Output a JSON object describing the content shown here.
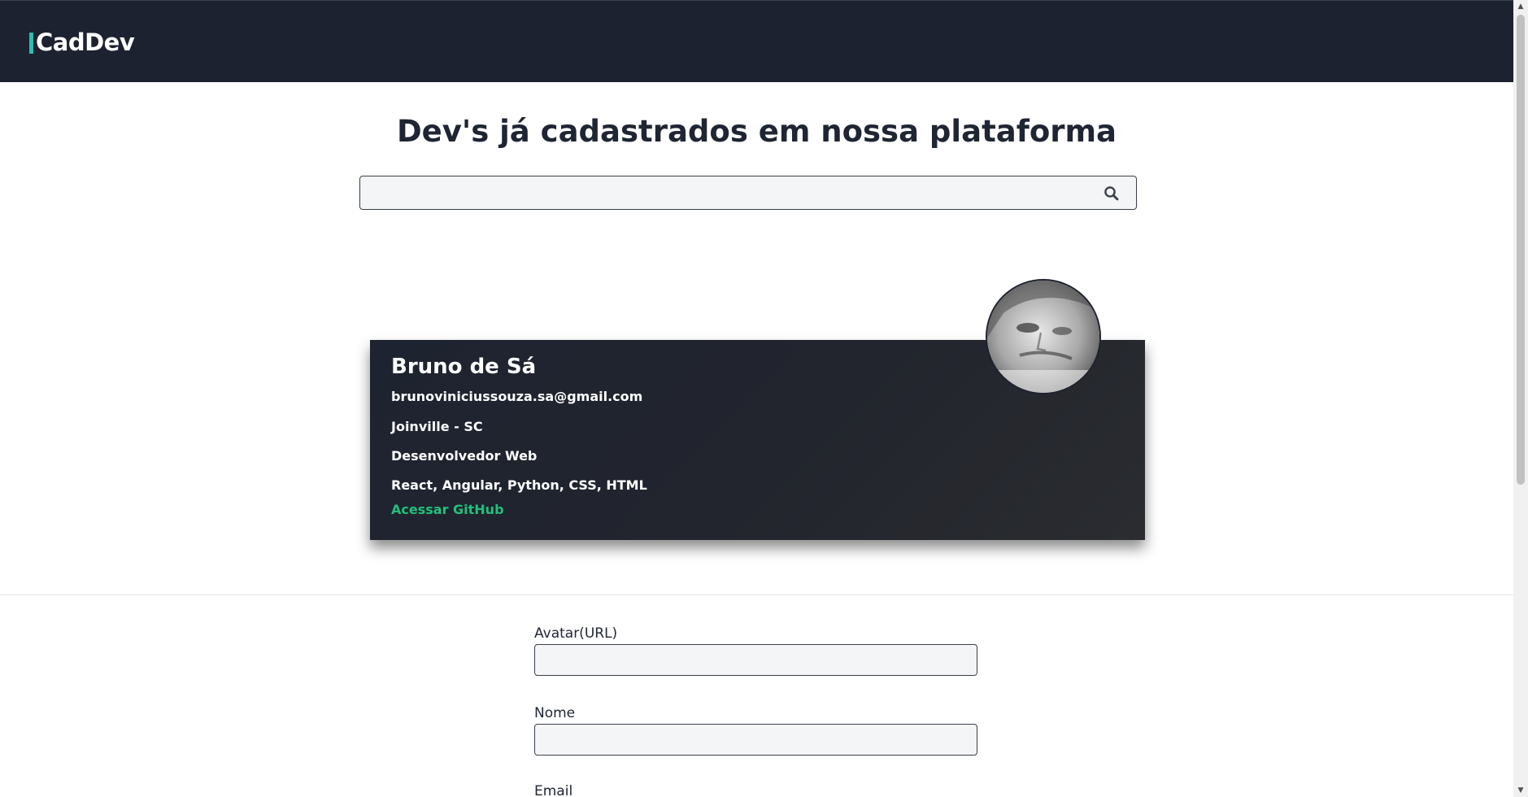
{
  "header": {
    "logo_text": "CadDev",
    "accent_color": "#2bbfb0",
    "background_color": "#1d2230"
  },
  "main": {
    "title": "Dev's já cadastrados em nossa plataforma",
    "search": {
      "value": "",
      "placeholder": "",
      "icon": "search-icon"
    }
  },
  "dev_card": {
    "name": "Bruno de Sá",
    "email": "brunoviniciussouza.sa@gmail.com",
    "location": "Joinville - SC",
    "role": "Desenvolvedor Web",
    "skills": "React, Angular, Python, CSS, HTML",
    "github_link_label": "Acessar GitHub",
    "link_color": "#21c07a",
    "avatar_icon": "user-avatar-photo"
  },
  "form": {
    "fields": [
      {
        "label": "Avatar(URL)",
        "value": ""
      },
      {
        "label": "Nome",
        "value": ""
      },
      {
        "label": "Email",
        "value": ""
      }
    ]
  },
  "scrollbar": {
    "up_glyph": "▲",
    "down_glyph": "▼"
  }
}
